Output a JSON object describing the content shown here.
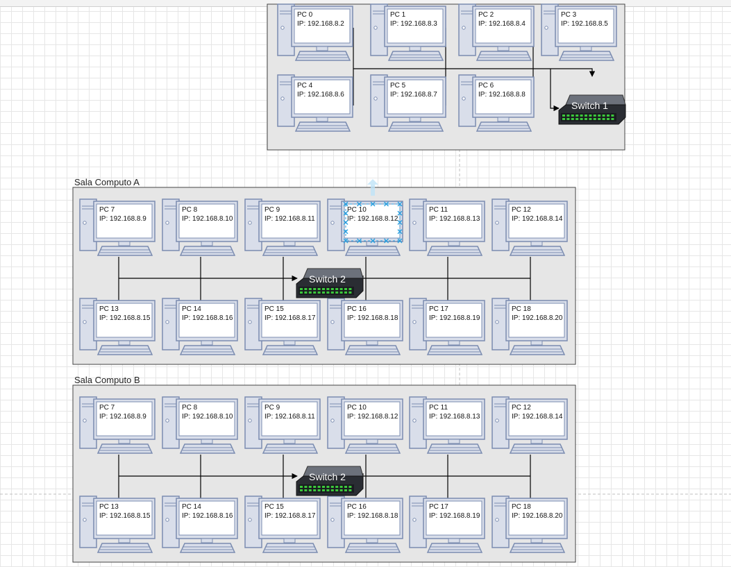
{
  "rooms": [
    {
      "id": "lab-top",
      "label": "",
      "switch_label": "Switch 1",
      "pcs": [
        {
          "name": "PC 0",
          "ip": "IP: 192.168.8.2"
        },
        {
          "name": "PC 1",
          "ip": "IP: 192.168.8.3"
        },
        {
          "name": "PC 2",
          "ip": "IP: 192.168.8.4"
        },
        {
          "name": "PC 3",
          "ip": "IP: 192.168.8.5"
        },
        {
          "name": "PC 4",
          "ip": "IP: 192.168.8.6"
        },
        {
          "name": "PC 5",
          "ip": "IP: 192.168.8.7"
        },
        {
          "name": "PC 6",
          "ip": "IP: 192.168.8.8"
        }
      ]
    },
    {
      "id": "sala-a",
      "label": "Sala Computo A",
      "switch_label": "Switch 2",
      "selected_pc": "PC 10",
      "pcs": [
        {
          "name": "PC 7",
          "ip": "IP: 192.168.8.9"
        },
        {
          "name": "PC 8",
          "ip": "IP: 192.168.8.10"
        },
        {
          "name": "PC 9",
          "ip": "IP: 192.168.8.11"
        },
        {
          "name": "PC 10",
          "ip": "IP: 192.168.8.12"
        },
        {
          "name": "PC 11",
          "ip": "IP: 192.168.8.13"
        },
        {
          "name": "PC 12",
          "ip": "IP: 192.168.8.14"
        },
        {
          "name": "PC 13",
          "ip": "IP: 192.168.8.15"
        },
        {
          "name": "PC 14",
          "ip": "IP: 192.168.8.16"
        },
        {
          "name": "PC 15",
          "ip": "IP: 192.168.8.17"
        },
        {
          "name": "PC 16",
          "ip": "IP: 192.168.8.18"
        },
        {
          "name": "PC 17",
          "ip": "IP: 192.168.8.19"
        },
        {
          "name": "PC 18",
          "ip": "IP: 192.168.8.20"
        }
      ]
    },
    {
      "id": "sala-b",
      "label": "Sala Computo B",
      "switch_label": "Switch 2",
      "pcs": [
        {
          "name": "PC 7",
          "ip": "IP: 192.168.8.9"
        },
        {
          "name": "PC 8",
          "ip": "IP: 192.168.8.10"
        },
        {
          "name": "PC 9",
          "ip": "IP: 192.168.8.11"
        },
        {
          "name": "PC 10",
          "ip": "IP: 192.168.8.12"
        },
        {
          "name": "PC 11",
          "ip": "IP: 192.168.8.13"
        },
        {
          "name": "PC 12",
          "ip": "IP: 192.168.8.14"
        },
        {
          "name": "PC 13",
          "ip": "IP: 192.168.8.15"
        },
        {
          "name": "PC 14",
          "ip": "IP: 192.168.8.16"
        },
        {
          "name": "PC 15",
          "ip": "IP: 192.168.8.17"
        },
        {
          "name": "PC 16",
          "ip": "IP: 192.168.8.18"
        },
        {
          "name": "PC 17",
          "ip": "IP: 192.168.8.19"
        },
        {
          "name": "PC 18",
          "ip": "IP: 192.168.8.20"
        }
      ]
    }
  ],
  "icons": {
    "pc": "desktop-computer-icon",
    "switch": "network-switch-icon",
    "connector": "blue-arrow-hint-icon"
  },
  "colors": {
    "room_fill": "#e6e6e6",
    "room_border": "#444444",
    "pc_outline": "#7b8cb0",
    "pc_fill": "#d9deea",
    "screen": "#ffffff",
    "wire": "#000000",
    "switch_body": "#2a2d33",
    "switch_port_led": "#3cc83c",
    "selection": "#29a0e0",
    "guide_line": "#bfbfbf"
  }
}
